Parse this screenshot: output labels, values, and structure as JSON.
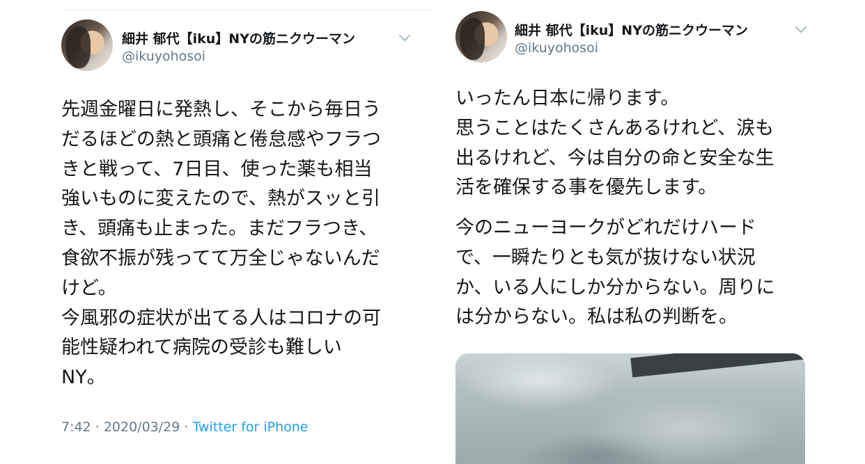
{
  "tweets": [
    {
      "author": {
        "name": "細井 郁代【iku】NYの筋ニクウーマン",
        "handle": "@ikuyohosoi"
      },
      "lines": [
        "先週金曜日に発熱し、そこから毎日う",
        "だるほどの熱と頭痛と倦怠感やフラつ",
        "きと戦って、7日目、使った薬も相当",
        "強いものに変えたので、熱がスッと引",
        "き、頭痛も止まった。まだフラつき、",
        "食欲不振が残ってて万全じゃないんだ",
        "けど。",
        "今風邪の症状が出てる人はコロナの可",
        "能性疑われて病院の受診も難しい",
        "NY。"
      ],
      "meta": {
        "time": "7:42",
        "date": "2020/03/29",
        "separator": "·",
        "source": "Twitter for iPhone"
      }
    },
    {
      "author": {
        "name": "細井 郁代【iku】NYの筋ニクウーマン",
        "handle": "@ikuyohosoi"
      },
      "paragraph1": [
        "いったん日本に帰ります。",
        "思うことはたくさんあるけれど、涙も",
        "出るけれど、今は自分の命と安全な生",
        "活を確保する事を優先します。"
      ],
      "paragraph2": [
        "今のニューヨークがどれだけハード",
        "で、一瞬たりとも気が抜けない状況",
        "か、いる人にしか分からない。周りに",
        "は分からない。私は私の判断を。"
      ]
    }
  ],
  "icons": {
    "menu": "chevron-down-icon"
  },
  "colors": {
    "text": "#14171a",
    "secondary": "#657786",
    "link": "#1da1f2"
  }
}
